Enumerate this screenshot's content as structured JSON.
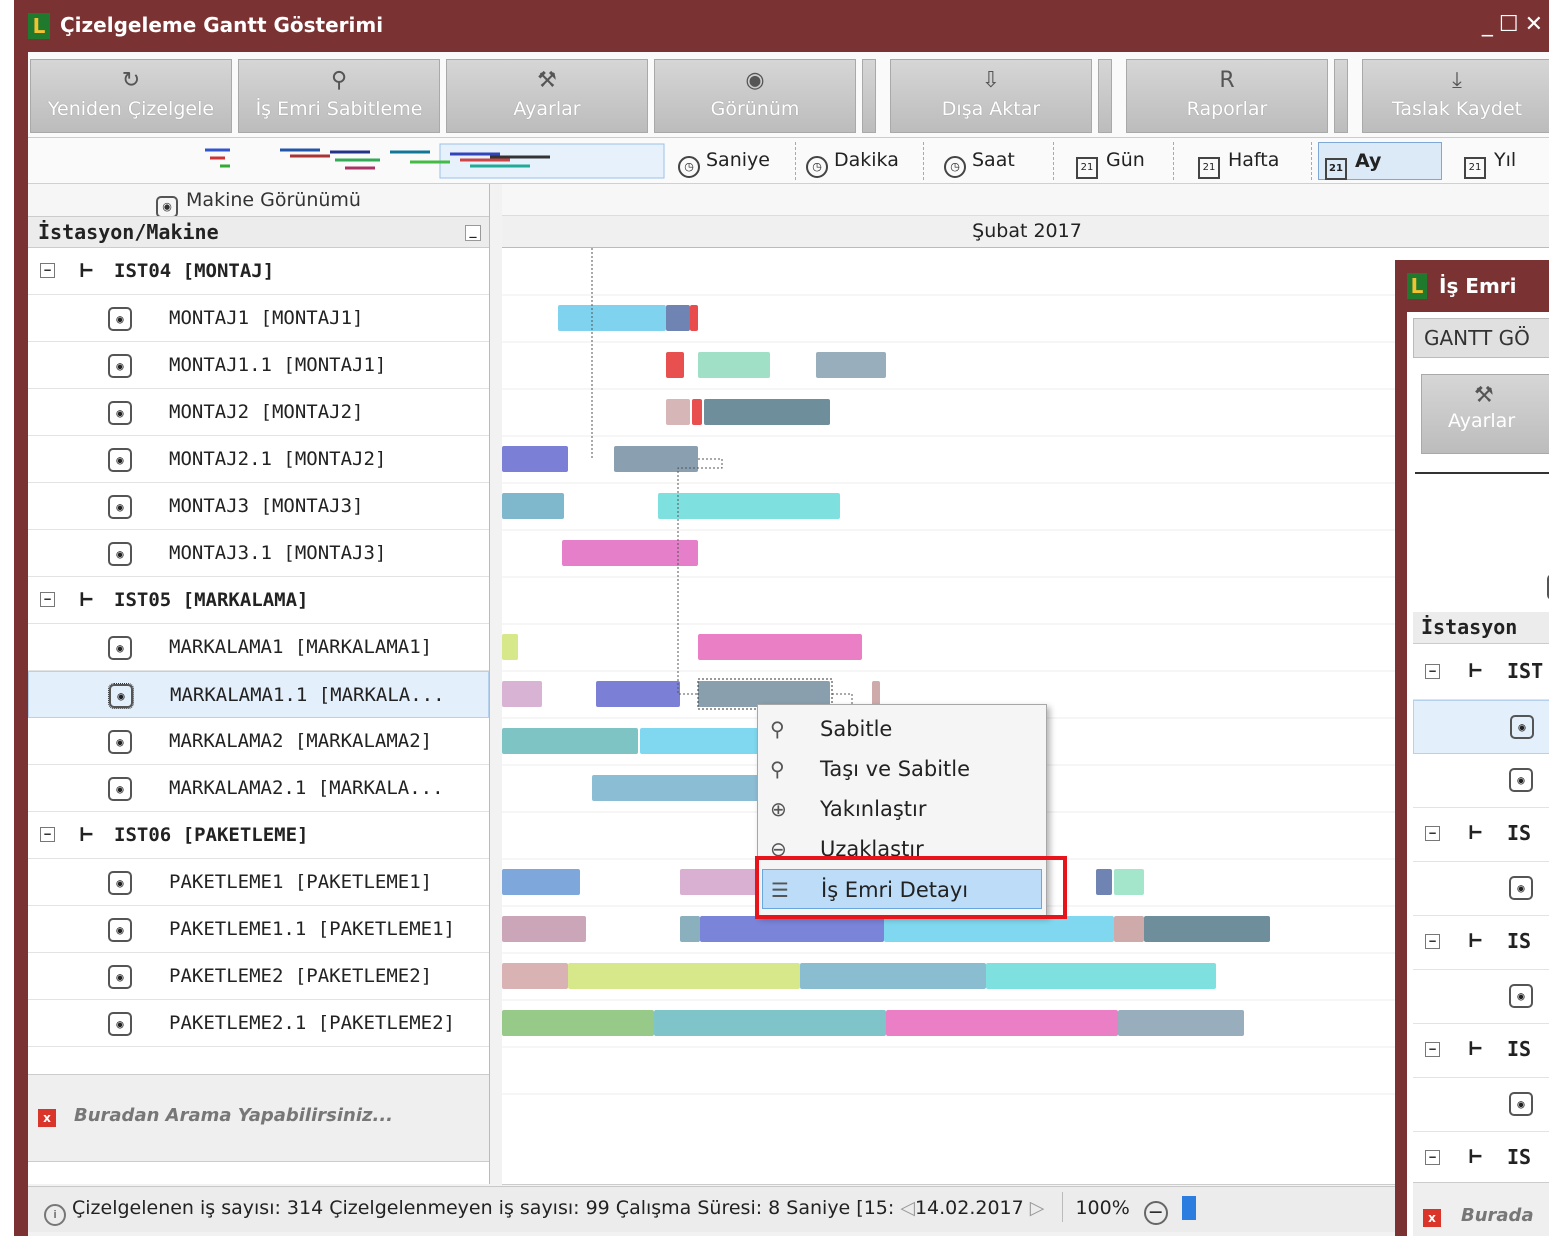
{
  "window": {
    "title": "Çizelgeleme Gantt Gösterimi",
    "logo_letter": "L",
    "controls": "_☐✕"
  },
  "ribbon": {
    "buttons": [
      {
        "label": "Yeniden Çizelgele",
        "icon": "refresh-icon",
        "glyph": "↻"
      },
      {
        "label": "İş Emri Sabitleme",
        "icon": "pin-icon",
        "glyph": "⚲"
      },
      {
        "label": "Ayarlar",
        "icon": "tools-icon",
        "glyph": "⚒"
      },
      {
        "label": "Görünüm",
        "icon": "view-icon",
        "glyph": "◉"
      },
      {
        "label": "Dışa Aktar",
        "icon": "export-icon",
        "glyph": "⇩"
      },
      {
        "label": "Raporlar",
        "icon": "report-icon",
        "glyph": "R"
      },
      {
        "label": "Taslak Kaydet",
        "icon": "save-draft-icon",
        "glyph": "⤓"
      }
    ]
  },
  "scales": [
    {
      "label": "Saniye",
      "icon": "stopwatch-icon",
      "active": false
    },
    {
      "label": "Dakika",
      "icon": "stopwatch-icon",
      "active": false
    },
    {
      "label": "Saat",
      "icon": "stopwatch-icon",
      "active": false
    },
    {
      "label": "Gün",
      "icon": "calendar-icon",
      "active": false
    },
    {
      "label": "Hafta",
      "icon": "calendar-icon",
      "active": false
    },
    {
      "label": "Ay",
      "icon": "calendar-icon",
      "active": true
    },
    {
      "label": "Yıl",
      "icon": "calendar-icon",
      "active": false
    }
  ],
  "left_panel": {
    "view_title": "Makine Görünümü",
    "column_header": "İstasyon/Makine",
    "rows": [
      {
        "type": "group",
        "label": "IST04 [MONTAJ]"
      },
      {
        "type": "machine",
        "label": "MONTAJ1 [MONTAJ1]"
      },
      {
        "type": "machine",
        "label": "MONTAJ1.1 [MONTAJ1]"
      },
      {
        "type": "machine",
        "label": "MONTAJ2 [MONTAJ2]"
      },
      {
        "type": "machine",
        "label": "MONTAJ2.1 [MONTAJ2]"
      },
      {
        "type": "machine",
        "label": "MONTAJ3 [MONTAJ3]"
      },
      {
        "type": "machine",
        "label": "MONTAJ3.1 [MONTAJ3]"
      },
      {
        "type": "group",
        "label": "IST05 [MARKALAMA]"
      },
      {
        "type": "machine",
        "label": "MARKALAMA1 [MARKALAMA1]"
      },
      {
        "type": "machine",
        "label": "MARKALAMA1.1 [MARKALA...",
        "selected": true
      },
      {
        "type": "machine",
        "label": "MARKALAMA2 [MARKALAMA2]"
      },
      {
        "type": "machine",
        "label": "MARKALAMA2.1 [MARKALA..."
      },
      {
        "type": "group",
        "label": "IST06 [PAKETLEME]"
      },
      {
        "type": "machine",
        "label": "PAKETLEME1 [PAKETLEME1]"
      },
      {
        "type": "machine",
        "label": "PAKETLEME1.1 [PAKETLEME1]"
      },
      {
        "type": "machine",
        "label": "PAKETLEME2 [PAKETLEME2]"
      },
      {
        "type": "machine",
        "label": "PAKETLEME2.1 [PAKETLEME2]"
      }
    ],
    "search_placeholder": "Buradan Arama Yapabilirsiniz..."
  },
  "gantt": {
    "period_label": "Şubat 2017"
  },
  "context_menu": {
    "items": [
      {
        "label": "Sabitle",
        "icon": "pin-icon",
        "glyph": "⚲",
        "highlighted": false
      },
      {
        "label": "Taşı ve Sabitle",
        "icon": "pin-icon",
        "glyph": "⚲",
        "highlighted": false
      },
      {
        "label": "Yakınlaştır",
        "icon": "zoom-in-icon",
        "glyph": "⊕",
        "highlighted": false
      },
      {
        "label": "Uzaklaştır",
        "icon": "zoom-out-icon",
        "glyph": "⊖",
        "highlighted": false
      },
      {
        "label": "İş Emri Detayı",
        "icon": "detail-chart-icon",
        "glyph": "☰",
        "highlighted": true
      }
    ]
  },
  "status_bar": {
    "text": "Çizelgelenen iş sayısı: 314 Çizelgelenmeyen iş sayısı: 99 Çalışma Süresi: 8 Saniye [15:",
    "date_fragment": "14.02.2017",
    "zoom": "100%"
  },
  "second_window": {
    "title": "İş Emri",
    "tab": "GANTT GÖ",
    "button": "Ayarlar",
    "column_header": "İstasyon",
    "group_label_1": "IST",
    "group_label": "IS",
    "search_placeholder": "Burada"
  },
  "colors": {
    "title_bar": "#7a3232",
    "highlight_box": "#e8141b",
    "menu_highlight": "#bcdcf7"
  }
}
